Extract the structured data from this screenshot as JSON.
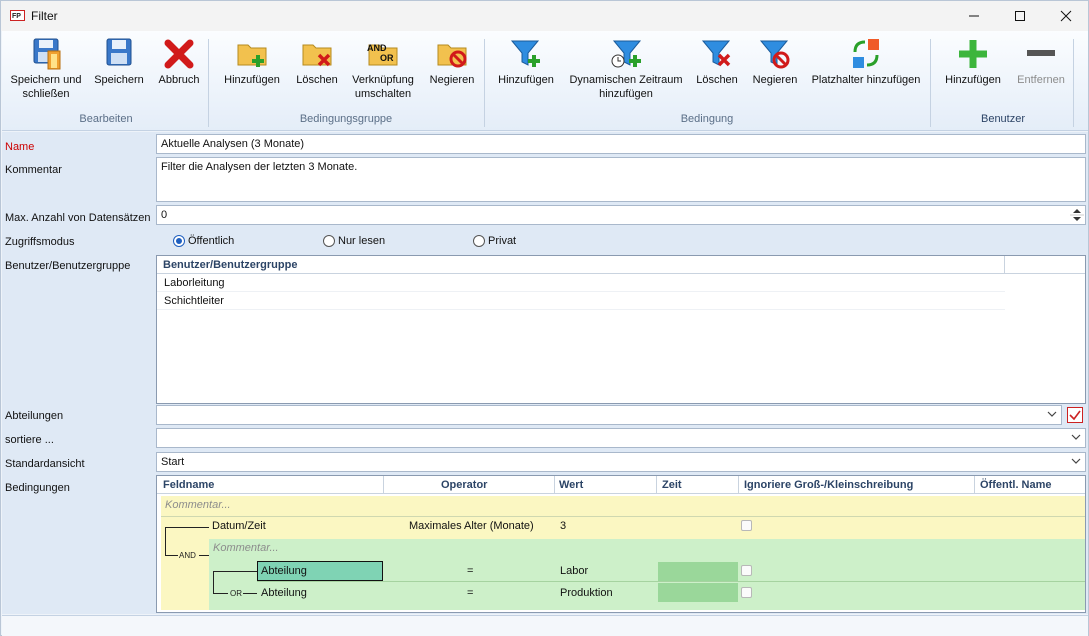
{
  "window": {
    "title": "Filter",
    "minimize_icon": "minimize-icon",
    "maximize_icon": "maximize-icon",
    "close_icon": "close-icon"
  },
  "ribbon": {
    "groups": [
      {
        "label": "Bearbeiten"
      },
      {
        "label": "Bedingungsgruppe"
      },
      {
        "label": "Bedingung"
      },
      {
        "label": "Benutzer"
      }
    ],
    "buttons": {
      "save_close": "Speichern und schließen",
      "save": "Speichern",
      "cancel": "Abbruch",
      "group_add": "Hinzufügen",
      "group_delete": "Löschen",
      "toggle_link": "Verknüpfung umschalten",
      "group_negate": "Negieren",
      "cond_add": "Hinzufügen",
      "cond_add_dynamic": "Dynamischen Zeitraum hinzufügen",
      "cond_delete": "Löschen",
      "cond_negate": "Negieren",
      "placeholder_add": "Platzhalter hinzufügen",
      "user_add": "Hinzufügen",
      "user_remove": "Entfernen"
    },
    "and_or_icon_text": {
      "and": "AND",
      "or": "OR"
    }
  },
  "form": {
    "labels": {
      "name": "Name",
      "comment": "Kommentar",
      "max_records": "Max. Anzahl von Datensätzen",
      "access_mode": "Zugriffsmodus",
      "users": "Benutzer/Benutzergruppe",
      "departments": "Abteilungen",
      "sort": "sortiere ...",
      "default_view": "Standardansicht",
      "conditions": "Bedingungen"
    },
    "name_value": "Aktuelle Analysen (3 Monate)",
    "comment_value": "Filter die Analysen der letzten 3 Monate.",
    "max_records_value": "0",
    "access_options": [
      "Öffentlich",
      "Nur lesen",
      "Privat"
    ],
    "access_selected": "Öffentlich",
    "users_grid": {
      "header": "Benutzer/Benutzergruppe",
      "rows": [
        "Laborleitung",
        "Schichtleiter"
      ]
    },
    "departments_value": "",
    "sort_value": "",
    "default_view_value": "Start"
  },
  "conditions": {
    "columns": [
      "Feldname",
      "Operator",
      "Wert",
      "Zeit",
      "Ignoriere Groß-/Kleinschreibung",
      "Öffentl. Name"
    ],
    "group_comment": "Kommentar...",
    "and_label": "AND",
    "or_label": "OR",
    "row1": {
      "field": "Datum/Zeit",
      "operator": "Maximales Alter (Monate)",
      "value": "3"
    },
    "sub_comment": "Kommentar...",
    "row2": {
      "field": "Abteilung",
      "operator": "=",
      "value": "Labor"
    },
    "row3": {
      "field": "Abteilung",
      "operator": "=",
      "value": "Produktion"
    }
  }
}
